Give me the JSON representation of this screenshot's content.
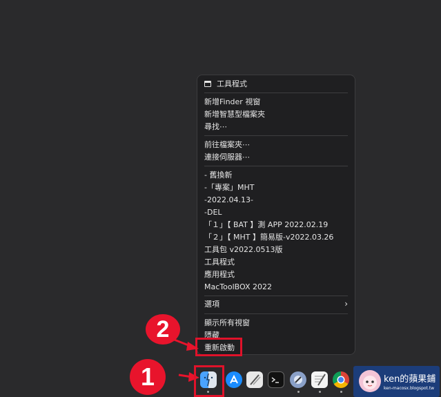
{
  "menu": {
    "header": "工具程式",
    "group1": [
      "新增Finder 視窗",
      "新增智慧型檔案夾",
      "尋找⋯"
    ],
    "group2": [
      "前往檔案夾⋯",
      "連接伺服器⋯"
    ],
    "group3": [
      "- 舊換新",
      "-「專案」MHT",
      "-2022.04.13-",
      "-DEL",
      "「１」【 BAT 】測 APP 2022.02.19",
      "「２」【 MHT 】簡易版-v2022.03.26",
      "工具包 v2022.0513版",
      "工具程式",
      "應用程式",
      "MacToolBOX      2022"
    ],
    "options": "選項",
    "group4": [
      "顯示所有視窗",
      "隱藏",
      "重新啟動"
    ]
  },
  "callouts": {
    "one": "1",
    "two": "2"
  },
  "watermark": {
    "title": "ken的蘋果鋪",
    "url": "ken-macosx.blogspot.tw"
  },
  "colors": {
    "highlight": "#e0122a",
    "menu_bg": "#1f1f21",
    "watermark_bg": "#1c3d7a"
  }
}
